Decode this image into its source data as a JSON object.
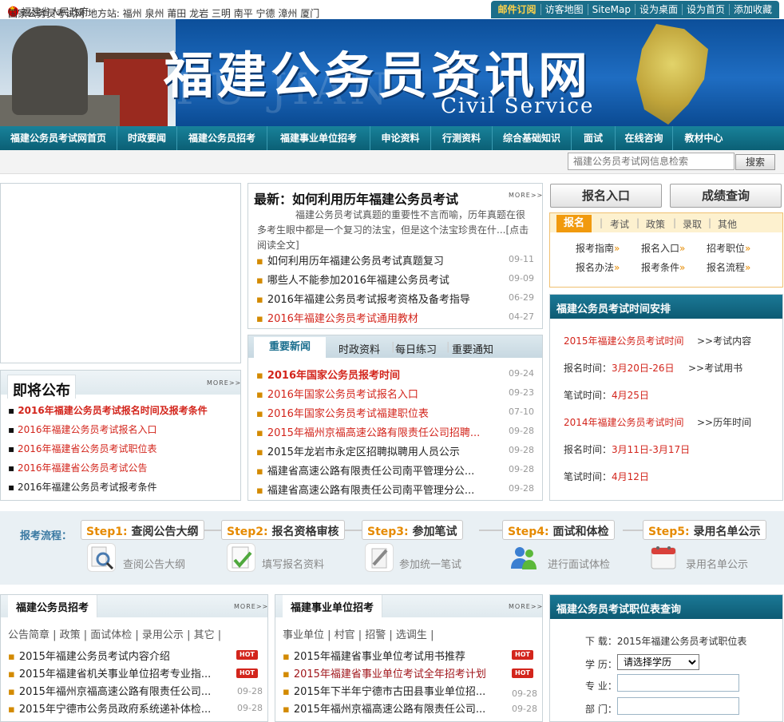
{
  "top": {
    "gov_name": "福建省人民政府",
    "links": [
      "邮件订阅",
      "访客地图",
      "SiteMap",
      "设为桌面",
      "设为首页",
      "添加收藏"
    ]
  },
  "banner": {
    "title": "福建公务员资讯网",
    "watermark": "FU JIAN",
    "subtitle": "Civil Service"
  },
  "nav": [
    "福建公务员考试网首页",
    "时政要闻",
    "福建公务员招考",
    "福建事业单位招考",
    "申论资料",
    "行测资料",
    "综合基础知识",
    "面试",
    "在线咨询",
    "教材中心"
  ],
  "stations": {
    "text": "国家公务员考试网 地方站: 福州 泉州 莆田 龙岩 三明 南平 宁德 漳州 厦门",
    "search_placeholder": "福建公务员考试网信息检索",
    "search_button": "搜索"
  },
  "more_label": "MORE>>",
  "news": {
    "headline": "最新：如何利用历年福建公务员考试",
    "summary": "福建公务员考试真题的重要性不言而喻，历年真题在很多考生眼中都是一个复习的法宝，但是这个法宝珍贵在什...[点击阅读全文]",
    "items": [
      {
        "title": "如何利用历年福建公务员考试真题复习",
        "date": "09-11",
        "red": false
      },
      {
        "title": "哪些人不能参加2016年福建公务员考试",
        "date": "09-09",
        "red": false
      },
      {
        "title": "2016年福建公务员考试报考资格及备考指导",
        "date": "06-29",
        "red": false
      },
      {
        "title": "2016年福建公务员考试通用教材",
        "date": "04-27",
        "red": true
      }
    ]
  },
  "important": {
    "tabs": [
      "重要新闻",
      "时政资料",
      "每日练习",
      "重要通知"
    ],
    "items": [
      {
        "title": "2016年国家公务员报考时间",
        "date": "09-24",
        "red": true,
        "bold": true
      },
      {
        "title": "2016年国家公务员考试报名入口",
        "date": "09-23",
        "red": true,
        "bold": false
      },
      {
        "title": "2016年国家公务员考试福建职位表",
        "date": "07-10",
        "red": true,
        "bold": false
      },
      {
        "title": "2015年福州京福高速公路有限责任公司招聘...",
        "date": "09-28",
        "red": true,
        "bold": false
      },
      {
        "title": "2015年龙岩市永定区招聘拟聘用人员公示",
        "date": "09-28",
        "red": false,
        "bold": false
      },
      {
        "title": "福建省高速公路有限责任公司南平管理分公...",
        "date": "09-28",
        "red": false,
        "bold": false
      },
      {
        "title": "福建省高速公路有限责任公司南平管理分公...",
        "date": "09-28",
        "red": false,
        "bold": false
      }
    ]
  },
  "soon": {
    "title": "即将公布",
    "items": [
      {
        "title": "2016年福建公务员考试报名时间及报考条件",
        "red": true,
        "bold": true
      },
      {
        "title": "2016年福建公务员考试报名入口",
        "red": true,
        "bold": false
      },
      {
        "title": "2016年福建省公务员考试职位表",
        "red": true,
        "bold": false
      },
      {
        "title": "2016年福建省公务员考试公告",
        "red": true,
        "bold": false
      },
      {
        "title": "2016年福建公务员考试报考条件",
        "red": false,
        "bold": false
      }
    ]
  },
  "right": {
    "btn_register": "报名入口",
    "btn_score": "成绩查询",
    "reg_tabs": [
      "报名",
      "考试",
      "政策",
      "录取",
      "其他"
    ],
    "reg_links": [
      "报考指南",
      "报名入口",
      "招考职位",
      "报名办法",
      "报考条件",
      "报名流程"
    ],
    "schedule_title": "福建公务员考试时间安排",
    "schedule": {
      "y2015_title": "2015年福建公务员考试时间",
      "y2015_link": "考试内容",
      "y2015_reg_label": "报名时间：",
      "y2015_reg": "3月20日-26日",
      "y2015_reg_link": "考试用书",
      "y2015_exam_label": "笔试时间：",
      "y2015_exam": "4月25日",
      "y2014_title": "2014年福建公务员考试时间",
      "y2014_link": "历年时间",
      "y2014_reg_label": "报名时间：",
      "y2014_reg": "3月11日-3月17日",
      "y2014_exam_label": "笔试时间：",
      "y2014_exam": "4月12日"
    }
  },
  "process": {
    "label": "报考流程：",
    "steps": [
      {
        "num": "Step1:",
        "text": "查阅公告大纲",
        "label": "查阅公告大纲"
      },
      {
        "num": "Step2:",
        "text": "报名资格审核",
        "label": "填写报名资料"
      },
      {
        "num": "Step3:",
        "text": "参加笔试",
        "label": "参加统一笔试"
      },
      {
        "num": "Step4:",
        "text": "面试和体检",
        "label": "进行面试体检"
      },
      {
        "num": "Step5:",
        "text": "录用名单公示",
        "label": "录用名单公示"
      }
    ]
  },
  "recruit": {
    "title": "福建公务员招考",
    "sub": "公告简章 | 政策 | 面试体检 | 录用公示 | 其它 |",
    "items": [
      {
        "title": "2015年福建公务员考试内容介绍",
        "hot": true,
        "date": ""
      },
      {
        "title": "2015年福建省机关事业单位招考专业指...",
        "hot": true,
        "date": ""
      },
      {
        "title": "2015年福州京福高速公路有限责任公司...",
        "hot": false,
        "date": "09-28"
      },
      {
        "title": "2015年宁德市公务员政府系统递补体检...",
        "hot": false,
        "date": "09-28"
      }
    ]
  },
  "shiye": {
    "title": "福建事业单位招考",
    "sub": "事业单位 | 村官 | 招警 | 选调生 |",
    "items": [
      {
        "title": "2015年福建省事业单位考试用书推荐",
        "hot": true,
        "date": "",
        "red": false
      },
      {
        "title": "2015年福建省事业单位考试全年招考计划",
        "hot": true,
        "date": "",
        "red": true
      },
      {
        "title": "2015年下半年宁德市古田县事业单位招...",
        "hot": false,
        "date": "09-28",
        "red": false
      },
      {
        "title": "2015年福州京福高速公路有限责任公司...",
        "hot": false,
        "date": "09-28",
        "red": false
      }
    ]
  },
  "hot_label": "HOT",
  "position": {
    "title": "福建公务员考试职位表查询",
    "download_label": "下 载：",
    "download_value": "2015年福建公务员考试职位表",
    "edu_label": "学 历：",
    "edu_selected": "请选择学历",
    "major_label": "专 业：",
    "dept_label": "部 门："
  }
}
